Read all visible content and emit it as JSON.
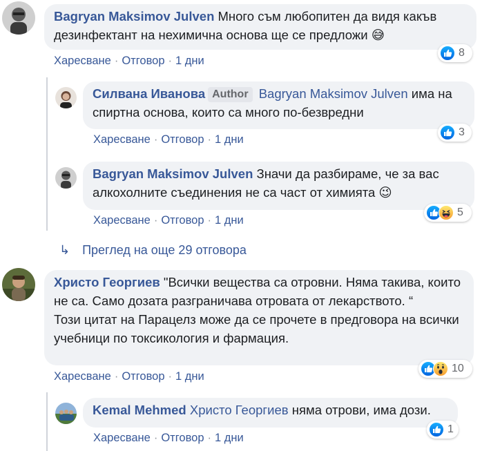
{
  "comments": [
    {
      "author": "Bagryan Maksimov Julven",
      "text": "Много съм любопитен да видя какъв дезинфектант на нехимична основа ще се предложи 😅",
      "actions": {
        "like": "Харесване",
        "reply": "Отговор",
        "time": "1 дни",
        "sep": "·"
      },
      "reactions": {
        "count": "8"
      }
    },
    {
      "author": "Силвана Иванова",
      "badge": "Author",
      "mention": "Bagryan Maksimov Julven",
      "text": "има на спиртна основа, които са много по-безвредни",
      "actions": {
        "like": "Харесване",
        "reply": "Отговор",
        "time": "1 дни",
        "sep": "·"
      },
      "reactions": {
        "count": "3"
      }
    },
    {
      "author": "Bagryan Maksimov Julven",
      "text": "Значи да разбираме, че за вас алкохолните съединения не са част от химията 😉",
      "actions": {
        "like": "Харесване",
        "reply": "Отговор",
        "time": "1 дни",
        "sep": "·"
      },
      "reactions": {
        "count": "5"
      }
    },
    {
      "author": "Христо Георгиев",
      "text_line1": "\"Всички вещества са отровни. Няма такива, които не са. Само дозата разграничава отровата от лекарството. “",
      "text_line2": "Този цитат на Парацелз може да се прочете в предговора на всички учебници по токсикология и фармация.",
      "actions": {
        "like": "Харесване",
        "reply": "Отговор",
        "time": "1 дни",
        "sep": "·"
      },
      "reactions": {
        "count": "10"
      }
    },
    {
      "author": "Kemal Mehmed",
      "mention": "Христо Георгиев",
      "text": "няма отрови, има дози.",
      "actions": {
        "like": "Харесване",
        "reply": "Отговор",
        "time": "1 дни",
        "sep": "·"
      },
      "reactions": {
        "count": "1"
      }
    }
  ],
  "more_replies": {
    "arrow": "↳",
    "label": "Преглед на още 29 отговора"
  },
  "icons": {
    "like": "like-icon",
    "haha": "haha-icon",
    "wow": "wow-icon",
    "arrow": "reply-arrow-icon"
  },
  "colors": {
    "link": "#385898",
    "bubble": "#f0f2f5",
    "like_blue": "#1877f2",
    "emoji_yellow": "#f7b928"
  }
}
